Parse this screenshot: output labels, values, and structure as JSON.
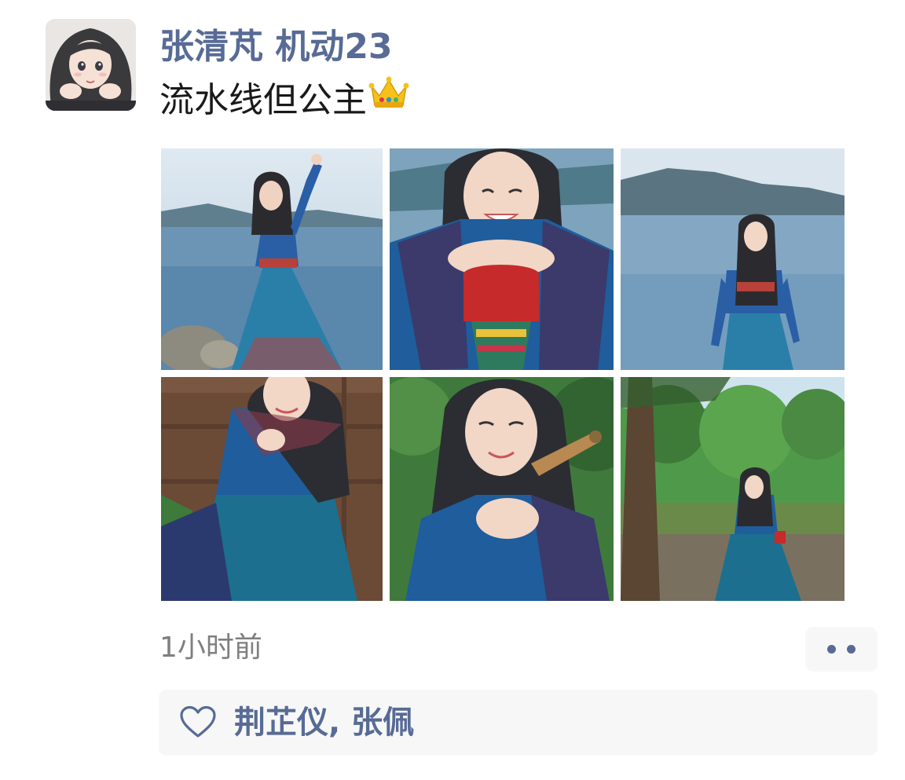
{
  "post": {
    "author_name": "张清芃 机动23",
    "text": "流水线但公主",
    "text_emoji": "crown-emoji",
    "timestamp": "1小时前",
    "photos": [
      {
        "icon": "lake-photo"
      },
      {
        "icon": "drum-portrait-photo"
      },
      {
        "icon": "lake-photo"
      },
      {
        "icon": "seated-portrait-photo"
      },
      {
        "icon": "instrument-portrait-photo"
      },
      {
        "icon": "garden-photo"
      }
    ]
  },
  "likes": {
    "icon": "heart-icon",
    "names": "荆芷仪, 张佩"
  },
  "colors": {
    "name_link": "#576b95",
    "body_text": "#191919",
    "timestamp": "#7f7f7f",
    "panel_bg": "#f7f7f7"
  }
}
